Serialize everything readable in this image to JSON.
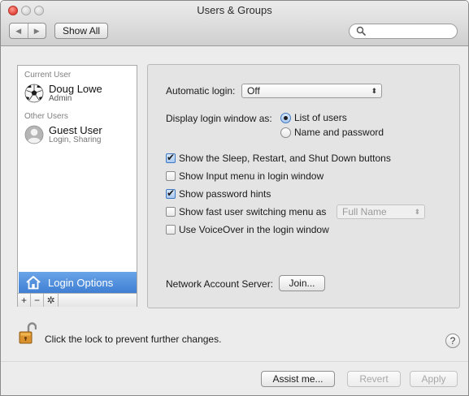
{
  "window": {
    "title": "Users & Groups"
  },
  "toolbar": {
    "back_icon": "◀",
    "forward_icon": "▶",
    "show_all_label": "Show All",
    "search_placeholder": "",
    "search_value": ""
  },
  "sidebar": {
    "current_user_header": "Current User",
    "current_user": {
      "name": "Doug Lowe",
      "role": "Admin"
    },
    "other_users_header": "Other Users",
    "other_users": [
      {
        "name": "Guest User",
        "role": "Login, Sharing"
      }
    ],
    "login_options_label": "Login Options",
    "add_label": "+",
    "remove_label": "−",
    "gear_label": "✲"
  },
  "panel": {
    "automatic_login_label": "Automatic login:",
    "automatic_login_value": "Off",
    "display_login_label": "Display login window as:",
    "display_options": [
      "List of users",
      "Name and password"
    ],
    "display_selected": "List of users",
    "checkboxes": [
      {
        "label": "Show the Sleep, Restart, and Shut Down buttons",
        "checked": true
      },
      {
        "label": "Show Input menu in login window",
        "checked": false
      },
      {
        "label": "Show password hints",
        "checked": true
      },
      {
        "label": "Show fast user switching menu as",
        "checked": false
      },
      {
        "label": "Use VoiceOver in the login window",
        "checked": false
      }
    ],
    "fast_switch_value": "Full Name",
    "network_server_label": "Network Account Server:",
    "join_label": "Join..."
  },
  "footer": {
    "lock_text": "Click the lock to prevent further changes.",
    "help_label": "?",
    "assist_label": "Assist me...",
    "revert_label": "Revert",
    "apply_label": "Apply"
  }
}
